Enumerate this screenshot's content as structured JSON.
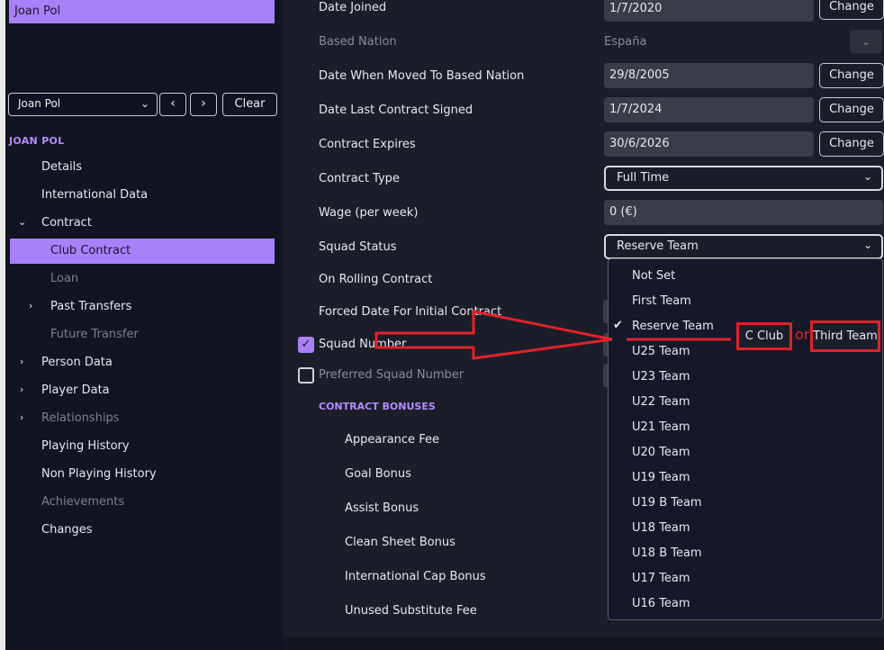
{
  "sidebar": {
    "top_tab": "Joan Pol",
    "person_select": "Joan Pol",
    "prev_label": "‹",
    "next_label": "›",
    "clear_label": "Clear",
    "section_title": "JOAN POL",
    "items": [
      {
        "label": "Details"
      },
      {
        "label": "International Data"
      },
      {
        "label": "Contract"
      },
      {
        "label": "Club Contract"
      },
      {
        "label": "Loan"
      },
      {
        "label": "Past Transfers"
      },
      {
        "label": "Future Transfer"
      },
      {
        "label": "Person Data"
      },
      {
        "label": "Player Data"
      },
      {
        "label": "Relationships"
      },
      {
        "label": "Playing History"
      },
      {
        "label": "Non Playing History"
      },
      {
        "label": "Achievements"
      },
      {
        "label": "Changes"
      }
    ]
  },
  "contract": {
    "date_joined": {
      "label": "Date Joined",
      "value": "1/7/2020",
      "button": "Change"
    },
    "based_nation": {
      "label": "Based Nation",
      "value": "España"
    },
    "date_moved": {
      "label": "Date When Moved To Based Nation",
      "value": "29/8/2005",
      "button": "Change"
    },
    "last_signed": {
      "label": "Date Last Contract Signed",
      "value": "1/7/2024",
      "button": "Change"
    },
    "expires": {
      "label": "Contract Expires",
      "value": "30/6/2026",
      "button": "Change"
    },
    "type": {
      "label": "Contract Type",
      "value": "Full Time"
    },
    "wage": {
      "label": "Wage (per week)",
      "value": "0 (€)"
    },
    "squad_status": {
      "label": "Squad Status",
      "value": "Reserve Team"
    },
    "rolling": {
      "label": "On Rolling Contract"
    },
    "forced_date": {
      "label": "Forced Date For Initial Contract"
    },
    "squad_number": {
      "label": "Squad Number",
      "checked": true
    },
    "preferred_number": {
      "label": "Preferred Squad Number",
      "checked": false
    }
  },
  "bonuses": {
    "title": "CONTRACT BONUSES",
    "items": [
      "Appearance Fee",
      "Goal Bonus",
      "Assist Bonus",
      "Clean Sheet Bonus",
      "International Cap Bonus",
      "Unused Substitute Fee"
    ]
  },
  "dropdown": {
    "options": [
      "Not Set",
      "First Team",
      "Reserve Team",
      "U25 Team",
      "U23 Team",
      "U22 Team",
      "U21 Team",
      "U20 Team",
      "U19 Team",
      "U19 B Team",
      "U18 Team",
      "U18 B Team",
      "U17 Team",
      "U16 Team"
    ],
    "selected": "Reserve Team"
  },
  "annotation": {
    "option_a": "C Club",
    "or": "or",
    "option_b": "Third Team"
  },
  "colors": {
    "accent": "#a880f7",
    "annotation": "#e0222b"
  },
  "icons": [
    "chevron-down-icon",
    "chevron-left-icon",
    "chevron-right-icon",
    "checkmark-icon",
    "arrow-right-icon"
  ]
}
